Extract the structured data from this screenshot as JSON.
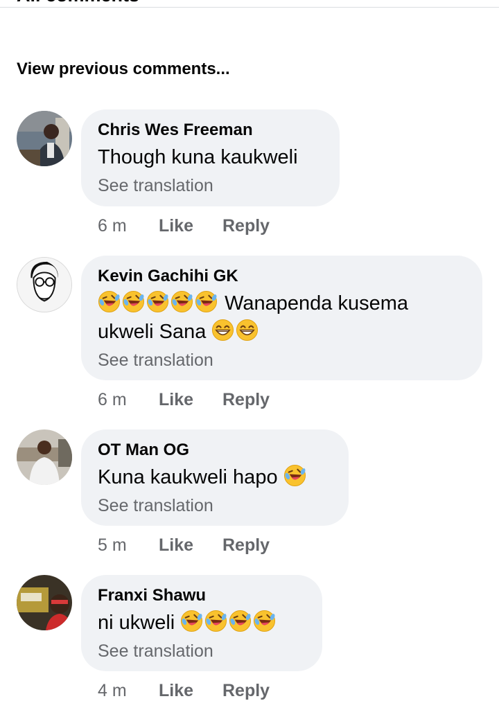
{
  "header": {
    "cut_title": "All comments",
    "view_previous": "View previous comments..."
  },
  "comments": [
    {
      "author": "Chris Wes Freeman",
      "text": "Though kuna kaukweli",
      "see_translation": "See translation",
      "time": "6 m",
      "like": "Like",
      "reply": "Reply"
    },
    {
      "author": "Kevin Gachihi GK",
      "text_after_emojis": "Wanapenda kusema",
      "text_line2": "ukweli Sana",
      "emojis_before": [
        "rolling-laughing",
        "rolling-laughing",
        "rolling-laughing",
        "rolling-laughing",
        "rolling-laughing"
      ],
      "emojis_after": [
        "grinning",
        "grinning"
      ],
      "see_translation": "See translation",
      "time": "6 m",
      "like": "Like",
      "reply": "Reply"
    },
    {
      "author": "OT Man OG",
      "text": "Kuna kaukweli hapo",
      "emojis_after": [
        "rolling-laughing"
      ],
      "see_translation": "See translation",
      "time": "5 m",
      "like": "Like",
      "reply": "Reply"
    },
    {
      "author": "Franxi Shawu",
      "text": "ni ukweli",
      "emojis_after": [
        "rolling-laughing",
        "rolling-laughing",
        "rolling-laughing",
        "rolling-laughing"
      ],
      "see_translation": "See translation",
      "time": "4 m",
      "like": "Like",
      "reply": "Reply"
    }
  ],
  "colors": {
    "bubble": "#f0f2f5",
    "meta_text": "#65676b",
    "primary_text": "#050505"
  }
}
